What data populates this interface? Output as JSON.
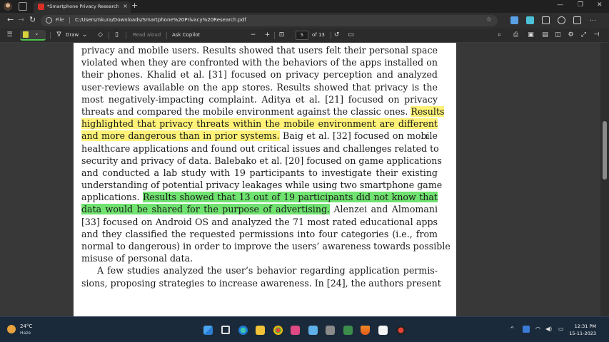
{
  "browser": {
    "tab_title": "*Smartphone Privacy Research.pdf",
    "tab_close": "×",
    "new_tab": "+",
    "minimize": "—",
    "maximize": "❐",
    "close": "✕",
    "back": "←",
    "forward": "→",
    "refresh": "↻",
    "address_prefix": "File",
    "address_path": "C:/Users/nkura/Downloads/Smartphone%20Privacy%20Research.pdf",
    "star": "☆",
    "accent_color": "#4cc24c"
  },
  "pdf_toolbar": {
    "contents_icon": "☰",
    "highlight_chevron": "⌄",
    "draw_label": "Draw",
    "read_aloud_label": "Read aloud",
    "ask_copilot_label": "Ask Copilot",
    "zoom_out": "−",
    "zoom_in": "+",
    "current_page": "5",
    "page_of": "of 13",
    "icons": [
      "list-icon",
      "highlighter-icon",
      "draw-icon",
      "eraser-icon",
      "page-view-icon",
      "fit-page-icon",
      "rotate-icon",
      "search-icon",
      "print-icon",
      "save-icon",
      "save-as-icon",
      "sidebar-icon",
      "settings-icon"
    ]
  },
  "document": {
    "lines": [
      {
        "plain": "privacy and mobile users. Results showed that users felt their personal space"
      },
      {
        "plain": "violated when they are confronted with the behaviors of the apps installed on"
      },
      {
        "plain": "their phones. Khalid et al. [31] focused on privacy perception and analyzed"
      },
      {
        "plain": "user-reviews available on the app stores. Results showed that privacy is the"
      },
      {
        "plain": "most negatively-impacting complaint. Aditya et al. [21] focused on privacy"
      },
      {
        "plain": "threats and compared the mobile environment against the classic ones. ",
        "yellow": "Results"
      },
      {
        "yellow": "highlighted that privacy threats within the mobile environment are different"
      },
      {
        "yellow": "and more dangerous than in prior systems.",
        "plain": " Baig et al. [32] focused on mobile"
      },
      {
        "plain": "healthcare applications and found out critical issues and challenges related to"
      },
      {
        "plain": "security and privacy of data. Balebako et al. [20] focused on game applications"
      },
      {
        "plain": "and conducted a lab study with 19 participants to investigate their existing"
      },
      {
        "plain": "understanding of potential privacy leakages while using two smartphone game"
      },
      {
        "plain": "applications. ",
        "green": "Results showed that 13 out of 19 participants did not know that"
      },
      {
        "green": "data would be shared for the purpose of advertising.",
        "plain": " Alenzei and Almomani"
      },
      {
        "plain": "[33] focused on Android OS and analyzed the 71 most rated educational apps"
      },
      {
        "plain": "and they classified the requested permissions into four categories (i.e., from"
      },
      {
        "plain": "normal to dangerous) in order to improve the users’ awareness towards possible"
      },
      {
        "plain": "misuse of personal data."
      },
      {
        "plain": "A few studies analyzed the user’s behavior regarding application permis-"
      },
      {
        "plain": "sions, proposing strategies to increase awareness. In [24], the authors present"
      }
    ],
    "highlight_yellow": "#fff277",
    "highlight_green": "#6fe26f"
  },
  "taskbar": {
    "temperature": "24°C",
    "weather": "Haze",
    "time": "12:31 PM",
    "date": "15-11-2023",
    "tray_chevron": "^",
    "wifi": "◠",
    "volume": "◀)",
    "battery": "▭"
  }
}
